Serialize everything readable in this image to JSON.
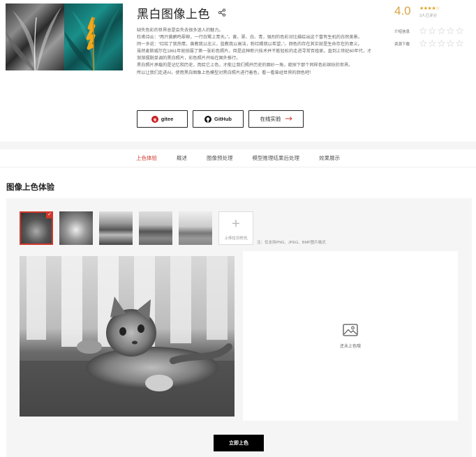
{
  "header": {
    "title": "黑白图像上色",
    "description": [
      "缺失色彩的世界总是会失去很多迷人的魅力。",
      "杜甫诗云：“两只黄鹂鸣翠柳，一行白鹭上青天。”。黄、翠、白、青，强烈的色彩对比描绘出这个富有生机的白然美景。",
      "同一多说：“红给了我热情，黄教我以忠义，蓝教我以高洁，粉红赐我以希望。”。颜色的存在其实就是生命存在的意义。",
      "虽然麦斯威尔在1861年就拍摄了第一张彩色照片。但是这种新兴技术并不能轻松的走进寻常百姓家。直到上世纪60年代，才渐渐摆脱单调的黑白照片，彩色照片开始在国外推行。",
      "黑白照片承载的是记忆和历史，而给它上色，才能让我们揭开历史的面纱一角，窥探下那个同样色彩缤纷的世界。",
      "所以让我们走进AI，使用黑白图像上色模型对黑白照片进行着色，看一看曾经世界的颜色吧！"
    ],
    "buttons": {
      "gitee": "gitee",
      "github": "GitHub",
      "online": "在线实验"
    }
  },
  "rating": {
    "score": "4.0",
    "stars": "★★★★☆",
    "count": "3人已评分",
    "rows": [
      {
        "label": "介绍信息",
        "stars": "☆☆☆☆☆"
      },
      {
        "label": "资源下载",
        "stars": "☆☆☆☆☆"
      }
    ]
  },
  "tabs": [
    "上色体验",
    "概述",
    "图像预处理",
    "模型推理结果后处理",
    "效果展示"
  ],
  "active_tab": "上色体验",
  "section_title": "图像上色体验",
  "samples": {
    "upload_label": "上传往日时光",
    "note": "注：仅支持PNG、JPEG、BMP图片格式"
  },
  "result": {
    "placeholder": "还未上色哦"
  },
  "colorize_button": "立即上色",
  "colors": {
    "accent": "#d0372b",
    "rating": "#d9a441",
    "panel": "#f5f5f5"
  },
  "icons": {
    "share": "share-icon",
    "gitee": "gitee-logo-icon",
    "github": "github-logo-icon",
    "online": "arrow-right-icon",
    "upload": "plus-icon",
    "result": "image-icon",
    "selected": "check-icon"
  }
}
